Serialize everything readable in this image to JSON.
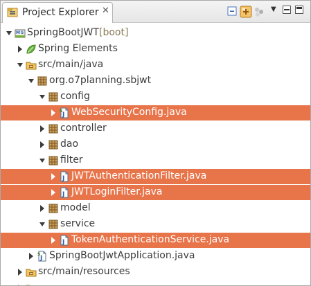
{
  "view": {
    "title": "Project Explorer",
    "close_glyph": "✕",
    "toolbar_icons": [
      "collapse-all-icon",
      "link-with-editor-icon",
      "filter-icon"
    ],
    "menu_glyph": "▼"
  },
  "tree": [
    {
      "label": "SpringBootJWT",
      "decoration": " [boot]",
      "icon": "spring-boot-project-icon",
      "expanded": true,
      "selected": false
    },
    {
      "label": "Spring Elements",
      "icon": "spring-leaf-icon",
      "expanded": false,
      "selected": false
    },
    {
      "label": "src/main/java",
      "icon": "source-folder-icon",
      "expanded": true,
      "selected": false
    },
    {
      "label": "org.o7planning.sbjwt",
      "icon": "package-icon",
      "expanded": true,
      "selected": false
    },
    {
      "label": "config",
      "icon": "package-icon",
      "expanded": true,
      "selected": false
    },
    {
      "label": "WebSecurityConfig.java",
      "icon": "spring-java-file-icon",
      "expanded": false,
      "selected": true
    },
    {
      "label": "controller",
      "icon": "package-icon",
      "expanded": false,
      "selected": false
    },
    {
      "label": "dao",
      "icon": "package-icon",
      "expanded": false,
      "selected": false
    },
    {
      "label": "filter",
      "icon": "package-icon",
      "expanded": true,
      "selected": false
    },
    {
      "label": "JWTAuthenticationFilter.java",
      "icon": "java-file-icon",
      "expanded": false,
      "selected": true
    },
    {
      "label": "JWTLoginFilter.java",
      "icon": "java-file-icon",
      "expanded": false,
      "selected": true
    },
    {
      "label": "model",
      "icon": "package-icon",
      "expanded": false,
      "selected": false
    },
    {
      "label": "service",
      "icon": "package-icon",
      "expanded": true,
      "selected": false
    },
    {
      "label": "TokenAuthenticationService.java",
      "icon": "java-file-icon",
      "expanded": false,
      "selected": true
    },
    {
      "label": "SpringBootJwtApplication.java",
      "icon": "spring-java-file-icon",
      "expanded": false,
      "selected": false
    },
    {
      "label": "src/main/resources",
      "icon": "source-folder-icon",
      "expanded": false,
      "selected": false
    },
    {
      "label": "",
      "icon": "source-folder-icon",
      "expanded": false,
      "selected": false
    }
  ],
  "colors": {
    "selection": "#e8744a",
    "decoration": "#8a7a55"
  }
}
